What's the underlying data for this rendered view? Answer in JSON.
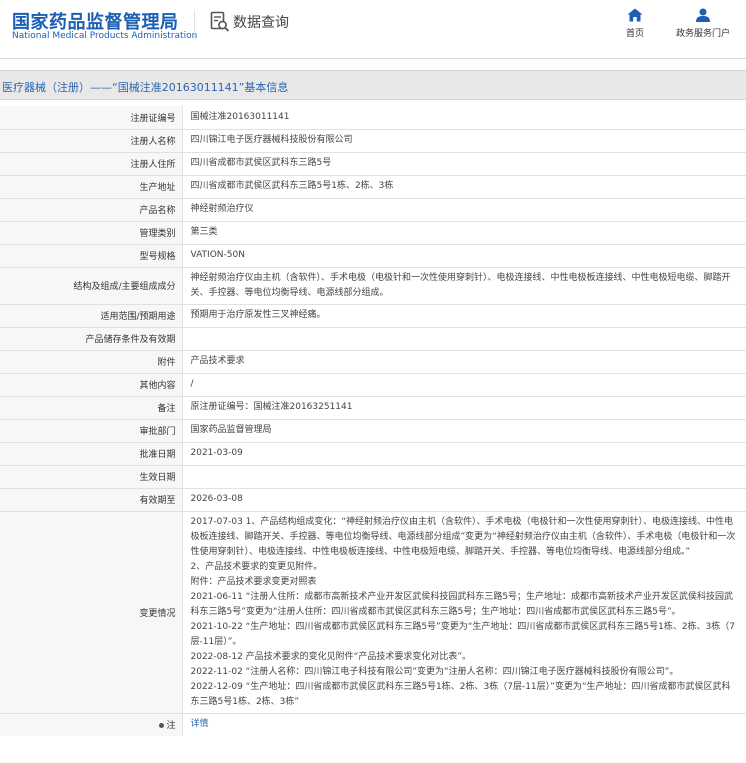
{
  "header": {
    "logo_cn": "国家药品监督管理局",
    "logo_en": "National Medical Products Administration",
    "search_title": "数据查询",
    "nav": [
      {
        "label": "首页",
        "icon": "home-icon"
      },
      {
        "label": "政务服务门户",
        "icon": "user-icon"
      }
    ]
  },
  "breadcrumb": "医疗器械（注册）——“国械注准20163011141”基本信息",
  "fields": [
    {
      "key": "注册证编号",
      "value": "国械注准20163011141"
    },
    {
      "key": "注册人名称",
      "value": "四川锦江电子医疗器械科技股份有限公司"
    },
    {
      "key": "注册人住所",
      "value": "四川省成都市武侯区武科东三路5号"
    },
    {
      "key": "生产地址",
      "value": "四川省成都市武侯区武科东三路5号1栋、2栋、3栋"
    },
    {
      "key": "产品名称",
      "value": "神经射频治疗仪"
    },
    {
      "key": "管理类别",
      "value": "第三类"
    },
    {
      "key": "型号规格",
      "value": "VATION-50N"
    },
    {
      "key": "结构及组成/主要组成成分",
      "value": "神经射频治疗仪由主机（含软件）、手术电极（电极针和一次性使用穿刺针）、电极连接线、中性电极板连接线、中性电极短电缆、脚踏开关、手控器、等电位均衡导线、电源线部分组成。"
    },
    {
      "key": "适用范围/预期用途",
      "value": "预期用于治疗原发性三叉神经痛。"
    },
    {
      "key": "产品储存条件及有效期",
      "value": ""
    },
    {
      "key": "附件",
      "value": "产品技术要求"
    },
    {
      "key": "其他内容",
      "value": "/"
    },
    {
      "key": "备注",
      "value": "原注册证编号：国械注准20163251141"
    },
    {
      "key": "审批部门",
      "value": "国家药品监督管理局"
    },
    {
      "key": "批准日期",
      "value": "2021-03-09"
    },
    {
      "key": "生效日期",
      "value": ""
    },
    {
      "key": "有效期至",
      "value": "2026-03-08"
    }
  ],
  "changes": {
    "key": "变更情况",
    "lines": [
      "2017-07-03 1、产品结构组成变化：“神经射频治疗仪由主机（含软件）、手术电极（电极针和一次性使用穿刺针）、电极连接线、中性电极板连接线、脚踏开关、手控器、等电位均衡导线、电源线部分组成”变更为“神经射频治疗仪由主机（含软件）、手术电极（电极针和一次性使用穿刺针）、电极连接线、中性电极板连接线、中性电极短电缆、脚踏开关、手控器、等电位均衡导线、电源线部分组成。”",
      "2、产品技术要求的变更见附件。",
      "附件：产品技术要求变更对照表",
      "2021-06-11 “注册人住所：成都市高新技术产业开发区武侯科技园武科东三路5号；生产地址：成都市高新技术产业开发区武侯科技园武科东三路5号”变更为“注册人住所：四川省成都市武侯区武科东三路5号；生产地址：四川省成都市武侯区武科东三路5号”。",
      "2021-10-22 “生产地址：四川省成都市武侯区武科东三路5号”变更为“生产地址：四川省成都市武侯区武科东三路5号1栋、2栋、3栋（7层-11层）”。",
      "2022-08-12 产品技术要求的变化见附件“产品技术要求变化对比表”。",
      "2022-11-02 “注册人名称：四川锦江电子科技有限公司”变更为“注册人名称：四川锦江电子医疗器械科技股份有限公司”。",
      "2022-12-09 “生产地址：四川省成都市武侯区武科东三路5号1栋、2栋、3栋（7层-11层）”变更为“生产地址：四川省成都市武侯区武科东三路5号1栋、2栋、3栋”"
    ]
  },
  "note": {
    "key": "注",
    "link": "详情"
  }
}
